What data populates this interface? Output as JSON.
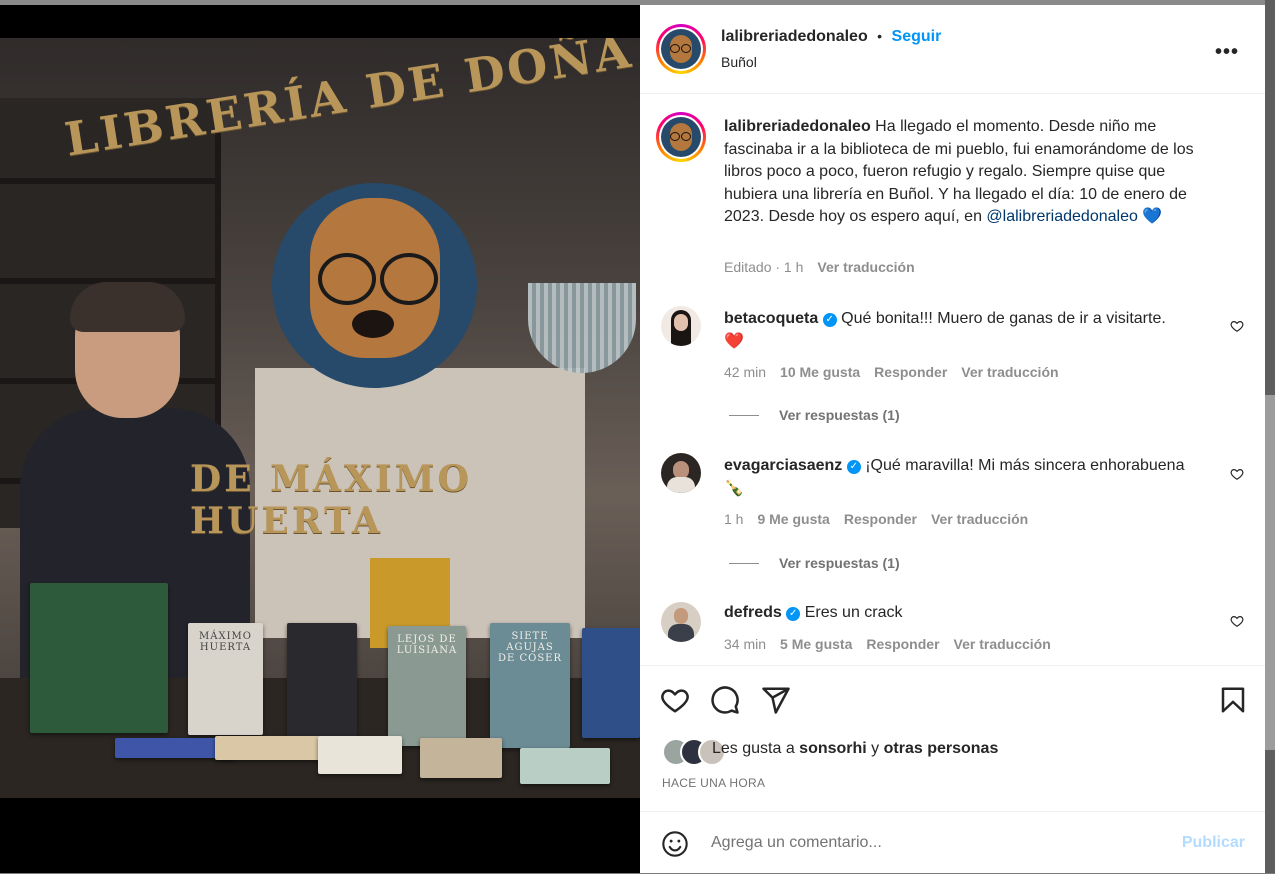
{
  "post": {
    "username": "lalibreriadedonaleo",
    "separator": "•",
    "follow_label": "Seguir",
    "location": "Buñol",
    "more_label": "•••"
  },
  "photo": {
    "sign_top": "LIBRERÍA DE DOÑA",
    "sign_bottom": "DE MÁXIMO HUERTA",
    "books": [
      "MÁXIMO HUERTA",
      "LEJOS DE LUISIANA",
      "SIETE AGUJAS DE COSER"
    ]
  },
  "caption": {
    "username": "lalibreriadedonaleo",
    "text": " Ha llegado el momento. Desde niño me fascinaba ir a la biblioteca de mi pueblo, fui enamorándome de los libros poco a poco, fueron refugio y regalo. Siempre quise que hubiera una librería en Buñol. Y ha llegado el día: 10 de enero de 2023. Desde hoy os espero aquí, en ",
    "mention": "@lalibreriadedonaleo",
    "emoji": "💙",
    "edited": "Editado · 1 h",
    "translate": "Ver traducción"
  },
  "comments": [
    {
      "username": "betacoqueta",
      "text": "Qué bonita!!! Muero de ganas de ir a visitarte.",
      "emoji": "❤️",
      "time": "42 min",
      "likes": "10 Me gusta",
      "reply": "Responder",
      "translate": "Ver traducción",
      "view_replies": "Ver respuestas (1)"
    },
    {
      "username": "evagarciasaenz",
      "text": "¡Qué maravilla! Mi más sincera enhorabuena",
      "emoji": "🍾",
      "time": "1 h",
      "likes": "9 Me gusta",
      "reply": "Responder",
      "translate": "Ver traducción",
      "view_replies": "Ver respuestas (1)"
    },
    {
      "username": "defreds",
      "text": "Eres un crack",
      "time": "34 min",
      "likes": "5 Me gusta",
      "reply": "Responder",
      "translate": "Ver traducción"
    }
  ],
  "likes": {
    "prefix": "Les gusta a ",
    "user": "sonsorhi",
    "middle": " y ",
    "others": "otras personas"
  },
  "time_ago": "HACE UNA HORA",
  "composer": {
    "placeholder": "Agrega un comentario...",
    "publish": "Publicar"
  },
  "icons": {
    "heart": "heart-icon",
    "comment": "comment-icon",
    "share": "paper-plane-icon",
    "save": "bookmark-icon",
    "emoji": "smiley-icon",
    "verified": "verified-badge-icon"
  },
  "colors": {
    "accent": "#0095f6",
    "text": "#262626",
    "muted": "#737373",
    "link": "#00376b",
    "publish_disabled": "#b3dbff"
  }
}
